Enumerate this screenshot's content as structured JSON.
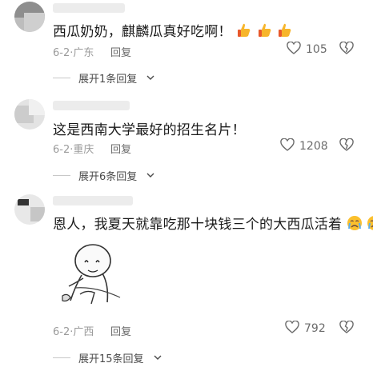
{
  "comments": [
    {
      "text": "西瓜奶奶，麒麟瓜真好吃啊！",
      "emoji": [
        "thumbs-up-icon",
        "thumbs-up-icon",
        "thumbs-up-icon"
      ],
      "date": "6-2",
      "location": "广东",
      "reply_label": "回复",
      "likes": "105",
      "expand_label": "展开1条回复"
    },
    {
      "text": "这是西南大学最好的招生名片！",
      "date": "6-2",
      "location": "重庆",
      "reply_label": "回复",
      "likes": "1208",
      "expand_label": "展开6条回复"
    },
    {
      "text": "恩人，我夏天就靠吃那十块钱三个的大西瓜活着",
      "emoji": [
        "crying-face-icon",
        "crying-face-icon"
      ],
      "date": "6-2",
      "location": "广西",
      "reply_label": "回复",
      "likes": "792",
      "expand_label": "展开15条回复"
    }
  ],
  "colors": {
    "meta": "#9b9b9b",
    "text": "#1a1a1a",
    "thumb": "#f7b52a",
    "crying_face": "#fbc02d",
    "tears": "#5aaef2"
  }
}
